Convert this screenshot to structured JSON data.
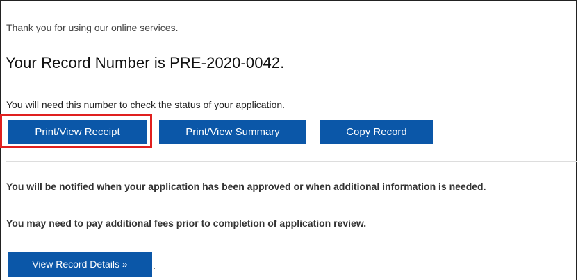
{
  "messages": {
    "thanks": "Thank you for using our online services.",
    "record_heading": "Your Record Number is PRE-2020-0042.",
    "need_number": "You will need this number to check the status of your application.",
    "notified": "You will be notified when your application has been approved or when additional information is needed.",
    "fees": "You may need to pay additional fees prior to completion of application review."
  },
  "actions": {
    "print_receipt": "Print/View Receipt",
    "print_summary": "Print/View Summary",
    "copy_record": "Copy Record",
    "view_details": "View Record Details »",
    "trailing_period": "."
  },
  "colors": {
    "button_bg": "#0b57a8",
    "button_text": "#ffffff",
    "highlight": "#e0201f"
  }
}
